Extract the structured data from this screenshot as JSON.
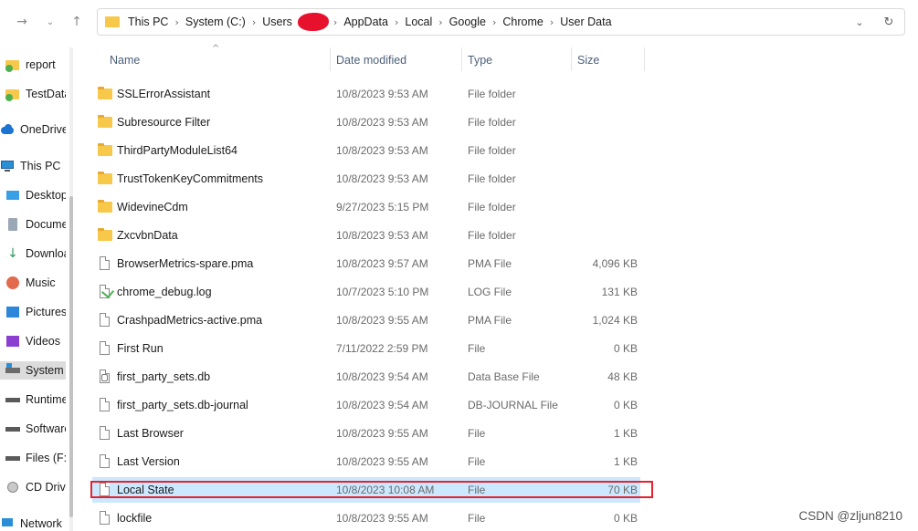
{
  "nav": {
    "breadcrumb": [
      "This PC",
      "System (C:)",
      "Users",
      "AppData",
      "Local",
      "Google",
      "Chrome",
      "User Data"
    ]
  },
  "sidebar": {
    "items": [
      {
        "label": "report",
        "icon": "folder-sync-icon"
      },
      {
        "label": "TestData",
        "icon": "folder-sync-icon"
      },
      {
        "label": "OneDrive",
        "icon": "cloud-icon"
      },
      {
        "label": "This PC",
        "icon": "monitor-icon"
      },
      {
        "label": "Desktop",
        "icon": "desktop-icon"
      },
      {
        "label": "Documents",
        "icon": "document-icon"
      },
      {
        "label": "Downloads",
        "icon": "download-icon"
      },
      {
        "label": "Music",
        "icon": "music-icon"
      },
      {
        "label": "Pictures",
        "icon": "picture-icon"
      },
      {
        "label": "Videos",
        "icon": "video-icon"
      },
      {
        "label": "System (C:)",
        "icon": "drive-icon"
      },
      {
        "label": "Runtime",
        "icon": "drive-icon"
      },
      {
        "label": "Software",
        "icon": "drive-icon"
      },
      {
        "label": "Files (F:)",
        "icon": "drive-icon"
      },
      {
        "label": "CD Drive",
        "icon": "disc-icon"
      },
      {
        "label": "Network",
        "icon": "network-icon"
      }
    ]
  },
  "columns": {
    "name": "Name",
    "date": "Date modified",
    "type": "Type",
    "size": "Size"
  },
  "files": [
    {
      "name": "SSLErrorAssistant",
      "date": "10/8/2023 9:53 AM",
      "type": "File folder",
      "size": "",
      "kind": "folder"
    },
    {
      "name": "Subresource Filter",
      "date": "10/8/2023 9:53 AM",
      "type": "File folder",
      "size": "",
      "kind": "folder"
    },
    {
      "name": "ThirdPartyModuleList64",
      "date": "10/8/2023 9:53 AM",
      "type": "File folder",
      "size": "",
      "kind": "folder"
    },
    {
      "name": "TrustTokenKeyCommitments",
      "date": "10/8/2023 9:53 AM",
      "type": "File folder",
      "size": "",
      "kind": "folder"
    },
    {
      "name": "WidevineCdm",
      "date": "9/27/2023 5:15 PM",
      "type": "File folder",
      "size": "",
      "kind": "folder"
    },
    {
      "name": "ZxcvbnData",
      "date": "10/8/2023 9:53 AM",
      "type": "File folder",
      "size": "",
      "kind": "folder"
    },
    {
      "name": "BrowserMetrics-spare.pma",
      "date": "10/8/2023 9:57 AM",
      "type": "PMA File",
      "size": "4,096 KB",
      "kind": "file"
    },
    {
      "name": "chrome_debug.log",
      "date": "10/7/2023 5:10 PM",
      "type": "LOG File",
      "size": "131 KB",
      "kind": "log"
    },
    {
      "name": "CrashpadMetrics-active.pma",
      "date": "10/8/2023 9:55 AM",
      "type": "PMA File",
      "size": "1,024 KB",
      "kind": "file"
    },
    {
      "name": "First Run",
      "date": "7/11/2022 2:59 PM",
      "type": "File",
      "size": "0 KB",
      "kind": "file"
    },
    {
      "name": "first_party_sets.db",
      "date": "10/8/2023 9:54 AM",
      "type": "Data Base File",
      "size": "48 KB",
      "kind": "db"
    },
    {
      "name": "first_party_sets.db-journal",
      "date": "10/8/2023 9:54 AM",
      "type": "DB-JOURNAL File",
      "size": "0 KB",
      "kind": "file"
    },
    {
      "name": "Last Browser",
      "date": "10/8/2023 9:55 AM",
      "type": "File",
      "size": "1 KB",
      "kind": "file"
    },
    {
      "name": "Last Version",
      "date": "10/8/2023 9:55 AM",
      "type": "File",
      "size": "1 KB",
      "kind": "file"
    },
    {
      "name": "Local State",
      "date": "10/8/2023 10:08 AM",
      "type": "File",
      "size": "70 KB",
      "kind": "file",
      "selected": true
    },
    {
      "name": "lockfile",
      "date": "10/8/2023 9:55 AM",
      "type": "File",
      "size": "0 KB",
      "kind": "file"
    }
  ],
  "watermark": "CSDN @zljun8210",
  "colors": {
    "selection": "#cce8ff",
    "highlight_border": "#e4232f",
    "folder": "#f8c84a"
  }
}
